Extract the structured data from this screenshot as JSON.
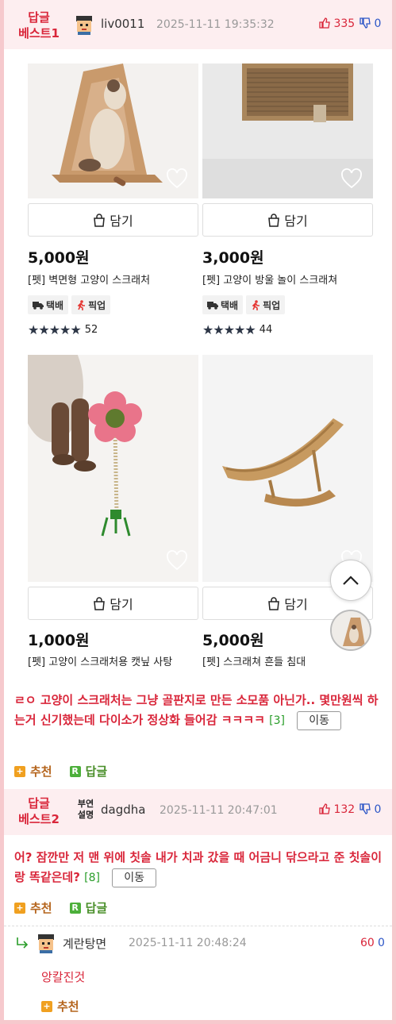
{
  "best1": {
    "tag": "답글\n베스트1",
    "tag_line1": "답글",
    "tag_line2": "베스트1",
    "nick": "liv0011",
    "date": "2025-11-11 19:35:32",
    "up": "335",
    "down": "0"
  },
  "products": [
    {
      "cart": "담기",
      "price": "5,000원",
      "name": "[펫] 벽면형 고양이 스크래처",
      "badge1": "택배",
      "badge2": "픽업",
      "rating": 5,
      "reviews": "52"
    },
    {
      "cart": "담기",
      "price": "3,000원",
      "name": "[펫] 고양이 방울 놀이 스크래쳐",
      "badge1": "택배",
      "badge2": "픽업",
      "rating": 5,
      "reviews": "44"
    },
    {
      "cart": "담기",
      "price": "1,000원",
      "name": "[펫] 고양이 스크래처용 캣닢 사탕"
    },
    {
      "cart": "담기",
      "price": "5,000원",
      "name": "[펫] 스크래쳐 흔들 침대"
    }
  ],
  "comment1": {
    "text": "ㄹㅇ 고양이 스크래처는 그냥 골판지로 만든 소모품 아닌가.. 몇만원씩 하는거 신기했는데 다이소가 정상화 들어감 ㅋㅋㅋㅋ",
    "count": "[3]",
    "move": "이동",
    "recommend": "추천",
    "reply": "답글"
  },
  "best2": {
    "tag_line1": "답글",
    "tag_line2": "베스트2",
    "nick": "dagdha",
    "avatar_text": "부연\n설명",
    "avatar_l1": "부연",
    "avatar_l2": "설명",
    "date": "2025-11-11 20:47:01",
    "up": "132",
    "down": "0"
  },
  "comment2": {
    "text": "어? 잠깐만 저 맨 위에 칫솔 내가 치과 갔을 때 어금니 닦으라고 준 칫솔이랑 똑같은데?",
    "count": "[8]",
    "move": "이동",
    "recommend": "추천",
    "reply": "답글"
  },
  "subreply": {
    "nick": "계란탕면",
    "date": "2025-11-11 20:48:24",
    "up": "60",
    "down": "0",
    "text": "앙칼진것",
    "recommend": "추천"
  },
  "colors": {
    "accent": "#d9263a",
    "pink_bg": "#fdeef0",
    "count_green": "#2a9d2a",
    "down_blue": "#2c56c7"
  },
  "icons": [
    "thumbs-up-icon",
    "thumbs-down-icon",
    "shopping-bag-icon",
    "heart-icon",
    "truck-icon",
    "pickup-icon",
    "star-icon",
    "chevron-up-icon",
    "reply-arrow-icon",
    "plus-square-icon",
    "reply-square-icon"
  ]
}
